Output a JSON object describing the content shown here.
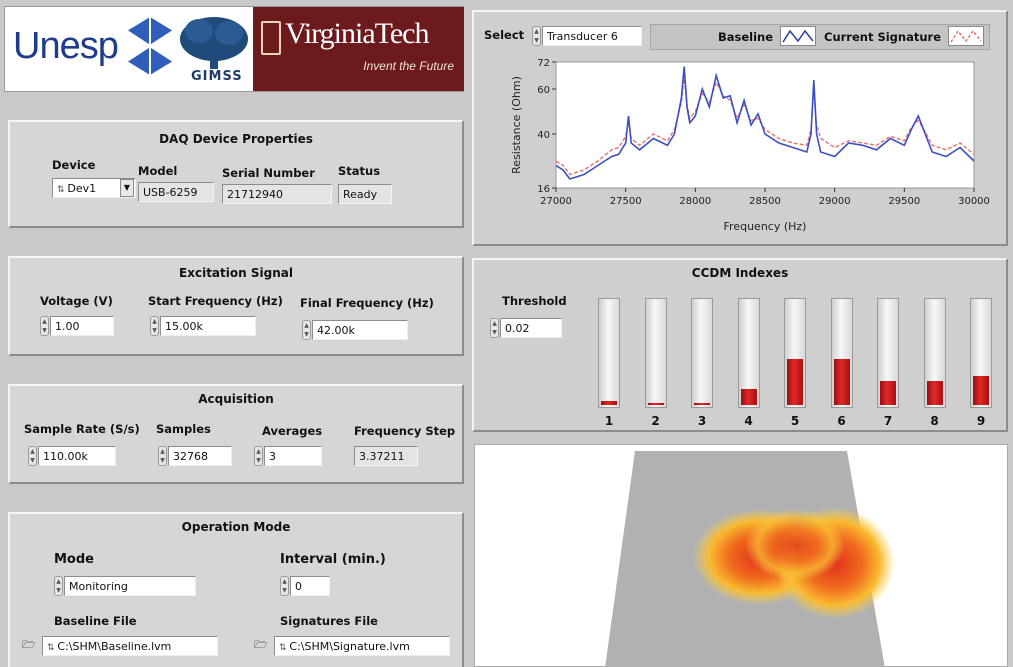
{
  "logos": {
    "unesp": "Unesp",
    "gimss": "GIMSS",
    "vt_name": "VirginiaTech",
    "vt_tagline": "Invent the Future"
  },
  "daq": {
    "title": "DAQ Device  Properties",
    "device_label": "Device",
    "device_value": "Dev1",
    "model_label": "Model",
    "model_value": "USB-6259",
    "serial_label": "Serial Number",
    "serial_value": "21712940",
    "status_label": "Status",
    "status_value": "Ready"
  },
  "excitation": {
    "title": "Excitation Signal",
    "voltage_label": "Voltage (V)",
    "voltage_value": "1.00",
    "start_label": "Start Frequency (Hz)",
    "start_value": "15.00k",
    "final_label": "Final Frequency (Hz)",
    "final_value": "42.00k"
  },
  "acquisition": {
    "title": "Acquisition",
    "rate_label": "Sample Rate (S/s)",
    "rate_value": "110.00k",
    "samples_label": "Samples",
    "samples_value": "32768",
    "averages_label": "Averages",
    "averages_value": "3",
    "step_label": "Frequency Step",
    "step_value": "3.37211"
  },
  "operation": {
    "title": "Operation Mode",
    "mode_label": "Mode",
    "mode_value": "Monitoring",
    "interval_label": "Interval (min.)",
    "interval_value": "0",
    "baseline_label": "Baseline File",
    "baseline_value": "C:\\SHM\\Baseline.lvm",
    "signatures_label": "Signatures File",
    "signatures_value": "C:\\SHM\\Signature.lvm"
  },
  "graph": {
    "select_label": "Select",
    "transducer_value": "Transducer 6",
    "legend_baseline": "Baseline",
    "legend_current": "Current Signature",
    "colors": {
      "baseline": "#3b4fc4",
      "current": "#e7746a"
    }
  },
  "ccdm": {
    "title": "CCDM Indexes",
    "threshold_label": "Threshold",
    "threshold_value": "0.02",
    "fill_color": "#d11f1f"
  },
  "chart_data": {
    "type": "line",
    "xlabel": "Frequency (Hz)",
    "ylabel": "Resistance (Ohm)",
    "xlim": [
      27000,
      30000
    ],
    "ylim": [
      16,
      72
    ],
    "xticks": [
      "27000",
      "27500",
      "28000",
      "28500",
      "29000",
      "29500",
      "30000"
    ],
    "yticks": [
      "16",
      "40",
      "60",
      "72"
    ],
    "series": [
      {
        "name": "Baseline",
        "x": [
          27000,
          27050,
          27100,
          27200,
          27300,
          27400,
          27450,
          27500,
          27520,
          27540,
          27600,
          27700,
          27800,
          27850,
          27900,
          27920,
          27940,
          27960,
          28000,
          28050,
          28100,
          28150,
          28200,
          28250,
          28300,
          28350,
          28400,
          28450,
          28500,
          28600,
          28700,
          28800,
          28830,
          28850,
          28870,
          28900,
          29000,
          29100,
          29200,
          29300,
          29400,
          29500,
          29550,
          29600,
          29650,
          29700,
          29800,
          29900,
          30000
        ],
        "y": [
          26,
          24,
          20,
          22,
          26,
          30,
          31,
          36,
          48,
          36,
          33,
          38,
          35,
          40,
          56,
          70,
          52,
          45,
          48,
          60,
          52,
          66,
          56,
          57,
          45,
          55,
          44,
          49,
          40,
          36,
          34,
          32,
          40,
          64,
          40,
          32,
          30,
          36,
          35,
          33,
          38,
          35,
          42,
          48,
          40,
          32,
          30,
          34,
          28
        ]
      },
      {
        "name": "Current Signature",
        "x": [
          27000,
          27050,
          27100,
          27200,
          27300,
          27400,
          27450,
          27500,
          27520,
          27540,
          27600,
          27700,
          27800,
          27850,
          27900,
          27920,
          27940,
          27960,
          28000,
          28050,
          28100,
          28150,
          28200,
          28250,
          28300,
          28350,
          28400,
          28450,
          28500,
          28600,
          28700,
          28800,
          28830,
          28850,
          28870,
          28900,
          29000,
          29100,
          29200,
          29300,
          29400,
          29500,
          29550,
          29600,
          29650,
          29700,
          29800,
          29900,
          30000
        ],
        "y": [
          28,
          26,
          22,
          24,
          28,
          33,
          34,
          39,
          46,
          38,
          35,
          40,
          37,
          42,
          54,
          66,
          53,
          47,
          50,
          58,
          54,
          63,
          57,
          55,
          47,
          53,
          46,
          47,
          42,
          38,
          36,
          35,
          42,
          60,
          44,
          38,
          34,
          37,
          36,
          35,
          39,
          37,
          43,
          46,
          41,
          35,
          33,
          36,
          31
        ]
      }
    ]
  },
  "ccdm_chart": {
    "type": "bar",
    "categories": [
      "1",
      "2",
      "3",
      "4",
      "5",
      "6",
      "7",
      "8",
      "9"
    ],
    "values": [
      0.04,
      0.02,
      0.02,
      0.15,
      0.44,
      0.44,
      0.23,
      0.23,
      0.28
    ],
    "ylim": [
      0,
      1
    ]
  }
}
